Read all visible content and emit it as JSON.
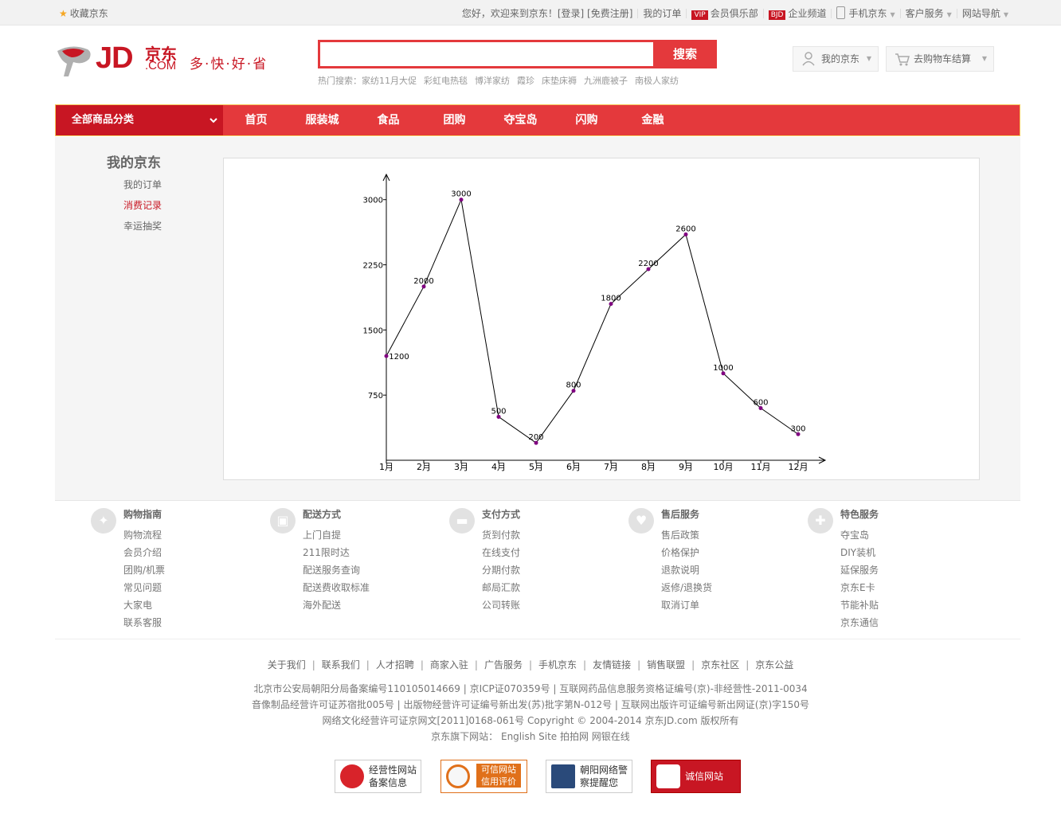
{
  "topbar": {
    "favorite": "收藏京东",
    "greeting": "您好，欢迎来到京东！[登录] [免费注册]",
    "my_orders": "我的订单",
    "vip_badge": "VIP",
    "member_club": "会员俱乐部",
    "bjd_badge": "BJD",
    "enterprise": "企业频道",
    "mobile": "手机京东",
    "service": "客户服务",
    "site_nav": "网站导航"
  },
  "header": {
    "logo_text": "JD",
    "logo_cn": "京东",
    "logo_com": ".COM",
    "slogan": "多·快·好·省",
    "search_placeholder": "",
    "search_button": "搜索",
    "hot_label": "热门搜索：",
    "hot_terms": [
      "家纺11月大促",
      "彩虹电热毯",
      "博洋家纺",
      "霞珍",
      "床垫床褥",
      "九洲鹿被子",
      "南极人家纺"
    ],
    "my_jd": "我的京东",
    "cart": "去购物车结算"
  },
  "nav": {
    "all_categories": "全部商品分类",
    "links": [
      "首页",
      "服装城",
      "食品",
      "团购",
      "夺宝岛",
      "闪购",
      "金融"
    ]
  },
  "sidebar": {
    "title": "我的京东",
    "items": [
      "我的订单",
      "消费记录",
      "幸运抽奖"
    ]
  },
  "chart_data": {
    "type": "line",
    "categories": [
      "1月",
      "2月",
      "3月",
      "4月",
      "5月",
      "6月",
      "7月",
      "8月",
      "9月",
      "10月",
      "11月",
      "12月"
    ],
    "values": [
      1200,
      2000,
      3000,
      500,
      200,
      800,
      1800,
      2200,
      2600,
      1000,
      600,
      300
    ],
    "yticks": [
      750,
      1500,
      2250,
      3000
    ],
    "ylim": [
      0,
      3300
    ],
    "line_color": "#000000",
    "point_color": "#800080"
  },
  "footer": {
    "columns": [
      {
        "icon": "compass-icon",
        "title": "购物指南",
        "links": [
          "购物流程",
          "会员介绍",
          "团购/机票",
          "常见问题",
          "大家电",
          "联系客服"
        ]
      },
      {
        "icon": "truck-icon",
        "title": "配送方式",
        "links": [
          "上门自提",
          "211限时达",
          "配送服务查询",
          "配送费收取标准",
          "海外配送"
        ]
      },
      {
        "icon": "wallet-icon",
        "title": "支付方式",
        "links": [
          "货到付款",
          "在线支付",
          "分期付款",
          "邮局汇款",
          "公司转账"
        ]
      },
      {
        "icon": "heart-icon",
        "title": "售后服务",
        "links": [
          "售后政策",
          "价格保护",
          "退款说明",
          "返修/退换货",
          "取消订单"
        ]
      },
      {
        "icon": "wrench-icon",
        "title": "特色服务",
        "links": [
          "夺宝岛",
          "DIY装机",
          "延保服务",
          "京东E卡",
          "节能补贴",
          "京东通信"
        ]
      }
    ],
    "links": [
      "关于我们",
      "联系我们",
      "人才招聘",
      "商家入驻",
      "广告服务",
      "手机京东",
      "友情链接",
      "销售联盟",
      "京东社区",
      "京东公益"
    ],
    "copy_lines": [
      "北京市公安局朝阳分局备案编号110105014669 | 京ICP证070359号 | 互联网药品信息服务资格证编号(京)-非经营性-2011-0034",
      "音像制品经营许可证苏宿批005号 | 出版物经营许可证编号新出发(苏)批字第N-012号 | 互联网出版许可证编号新出网证(京)字150号",
      "网络文化经营许可证京网文[2011]0168-061号 Copyright © 2004-2014 京东JD.com 版权所有",
      "京东旗下网站： English Site 拍拍网 网银在线"
    ],
    "certs": [
      {
        "line1": "经营性网站",
        "line2": "备案信息"
      },
      {
        "line1": "可信网站",
        "line2": "信用评价"
      },
      {
        "line1": "朝阳网络警",
        "line2": "察提醒您"
      },
      {
        "line1": "诚信网站",
        "line2": ""
      }
    ]
  }
}
